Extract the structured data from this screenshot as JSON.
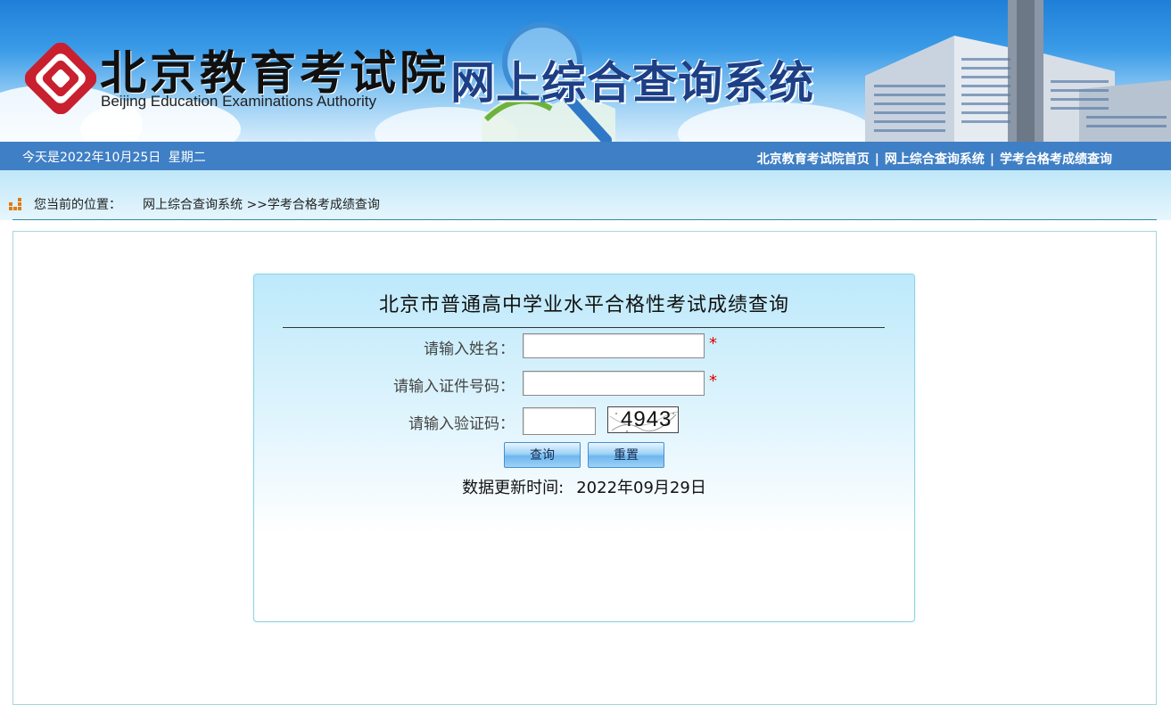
{
  "banner": {
    "logo_cn": "北京教育考试院",
    "logo_en": "Beijing Education Examinations Authority",
    "system_title": "网上综合查询系统"
  },
  "navbar": {
    "date_label": "今天是2022年10月25日",
    "weekday": "星期二",
    "links": [
      {
        "label": "北京教育考试院首页"
      },
      {
        "label": "网上综合查询系统"
      },
      {
        "label": "学考合格考成绩查询"
      }
    ],
    "separator": "|"
  },
  "breadcrumb": {
    "label": "您当前的位置：",
    "path_root": "网上综合查询系统",
    "path_current": ">>学考合格考成绩查询"
  },
  "form": {
    "title": "北京市普通高中学业水平合格性考试成绩查询",
    "name_label": "请输入姓名：",
    "name_value": "",
    "id_label": "请输入证件号码：",
    "id_value": "",
    "captcha_label": "请输入验证码：",
    "captcha_value": "",
    "captcha_image_text": "4943",
    "required_mark": "*",
    "query_button": "查询",
    "reset_button": "重置",
    "update_label": "数据更新时间:",
    "update_date": "2022年09月29日"
  },
  "colors": {
    "navbar": "#3f7fc5",
    "title_blue": "#1c3f86",
    "required": "#e00000",
    "panel_border": "#8ed3e6"
  }
}
